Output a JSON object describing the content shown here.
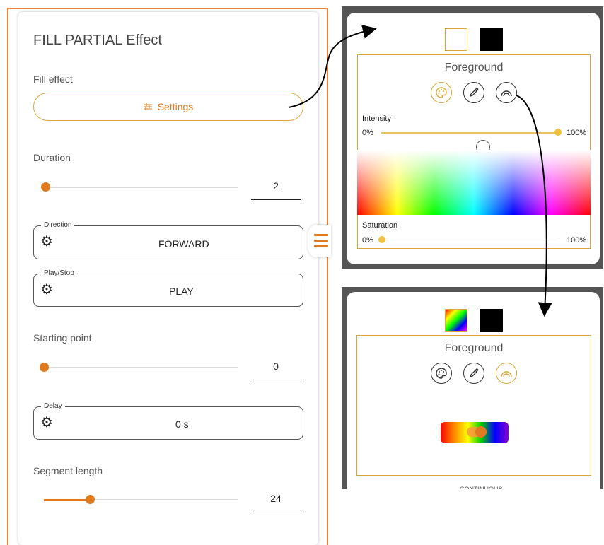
{
  "left_panel": {
    "title": "FILL PARTIAL Effect",
    "fill_effect_label": "Fill effect",
    "settings_label": "Settings",
    "duration": {
      "label": "Duration",
      "value": "2"
    },
    "direction": {
      "legend": "Direction",
      "value": "FORWARD"
    },
    "play_stop": {
      "legend": "Play/Stop",
      "value": "PLAY"
    },
    "starting_point": {
      "label": "Starting point",
      "value": "0"
    },
    "delay": {
      "legend": "Delay",
      "value": "0 s"
    },
    "segment_length": {
      "label": "Segment length",
      "value": "24"
    }
  },
  "color_panel_top": {
    "foreground_label": "Foreground",
    "intensity": {
      "label": "Intensity",
      "min": "0%",
      "max": "100%",
      "level": 1.0
    },
    "saturation": {
      "label": "Saturation",
      "min": "0%",
      "max": "100%",
      "level": 0.0
    }
  },
  "color_panel_bottom": {
    "foreground_label": "Foreground",
    "partial_text": "CONTINUOUS"
  },
  "colors": {
    "accent": "#e07a1e",
    "gold": "#e0a53a",
    "frame": "#555555"
  },
  "icons": [
    "settings-sliders-icon",
    "gear-icon",
    "menu-icon",
    "palette-icon",
    "eyedropper-icon",
    "rainbow-icon",
    "arrow-icon"
  ]
}
